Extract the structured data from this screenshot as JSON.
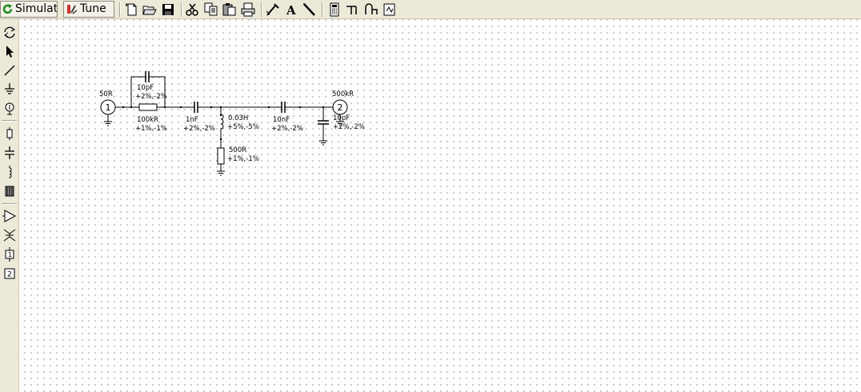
{
  "toolbar": {
    "simulate_label": "Simulati",
    "tune_label": "Tune",
    "icons": [
      "new-document-icon",
      "open-folder-icon",
      "save-icon",
      "cut-icon",
      "copy-icon",
      "paste-icon",
      "print-icon",
      "edit-component-icon",
      "text-tool-icon",
      "draw-line-icon",
      "calculator-icon",
      "wire-tool-icon",
      "port-tool-icon",
      "toggle-icon"
    ]
  },
  "sidebar": {
    "icons": [
      "rotate-icon",
      "pointer-icon",
      "wire-icon",
      "ground-icon",
      "port-icon",
      "resistor-icon",
      "capacitor-icon",
      "inductor-icon",
      "transformer-icon",
      "amplifier-icon",
      "transistor-icon",
      "one-port-icon",
      "two-port-icon"
    ]
  },
  "schematic": {
    "port1": {
      "number": "1",
      "impedance": "50R"
    },
    "port2": {
      "number": "2",
      "impedance": "500kR"
    },
    "c_parallel": {
      "value": "10pF",
      "tolerance": "+2%,-2%"
    },
    "r_series": {
      "value": "100kR",
      "tolerance": "+1%,-1%"
    },
    "c_series1": {
      "value": "1nF",
      "tolerance": "+2%,-2%"
    },
    "l_shunt": {
      "value": "0.03H",
      "tolerance": "+5%,-5%"
    },
    "r_shunt": {
      "value": "500R",
      "tolerance": "+1%,-1%"
    },
    "c_series2": {
      "value": "10nF",
      "tolerance": "+2%,-2%"
    },
    "c_shunt": {
      "value": "10pF",
      "tolerance": "+2%,-2%"
    }
  }
}
